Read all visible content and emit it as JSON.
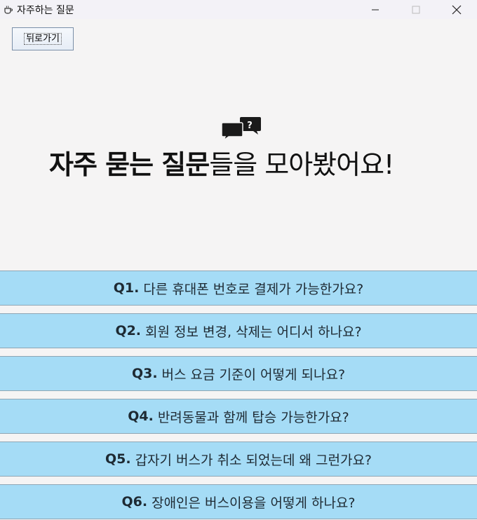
{
  "window": {
    "title": "자주하는 질문"
  },
  "back_button": {
    "label": "뒤로가기"
  },
  "hero": {
    "title_bold": "자주 묻는 질문",
    "title_regular": "들을 모아봤어요!",
    "icon": "chat-bubbles-question-icon"
  },
  "faq": [
    {
      "num": "Q1.",
      "question": "다른 휴대폰 번호로 결제가 가능한가요?"
    },
    {
      "num": "Q2.",
      "question": "회원 정보 변경, 삭제는 어디서 하나요?"
    },
    {
      "num": "Q3.",
      "question": "버스 요금 기준이 어떻게 되나요?"
    },
    {
      "num": "Q4.",
      "question": "반려동물과 함께 탑승 가능한가요?"
    },
    {
      "num": "Q5.",
      "question": "갑자기 버스가 취소 되었는데 왜 그런가요?"
    },
    {
      "num": "Q6.",
      "question": "장애인은 버스이용을 어떻게 하나요?"
    }
  ],
  "colors": {
    "faq_background": "#a5dcf6",
    "page_background": "#f5f4f4"
  }
}
